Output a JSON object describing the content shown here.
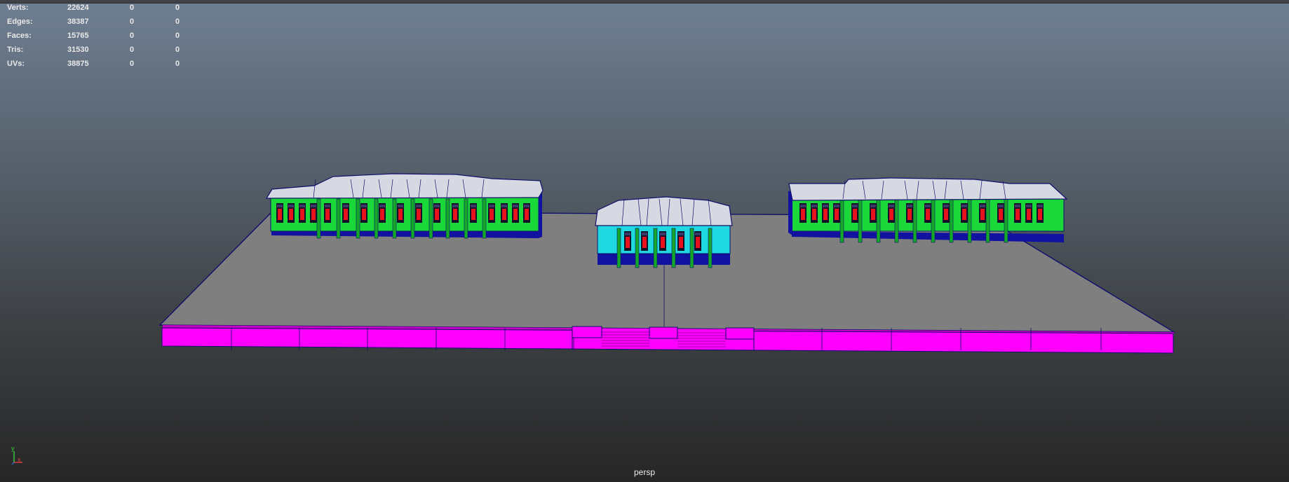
{
  "viewport": {
    "camera_label": "persp",
    "background_top": "#6f7f92",
    "background_bottom": "#262626"
  },
  "hud": {
    "rows": [
      {
        "label": "Verts:",
        "values": [
          "22624",
          "0",
          "0"
        ]
      },
      {
        "label": "Edges:",
        "values": [
          "38387",
          "0",
          "0"
        ]
      },
      {
        "label": "Faces:",
        "values": [
          "15765",
          "0",
          "0"
        ]
      },
      {
        "label": "Tris:",
        "values": [
          "31530",
          "0",
          "0"
        ]
      },
      {
        "label": "UVs:",
        "values": [
          "38875",
          "0",
          "0"
        ]
      }
    ]
  },
  "colors": {
    "platform": "#7f7f7f",
    "wall": "#1bd83a",
    "column": "#14a82a",
    "window_red": "#e8121c",
    "window_frame": "#101028",
    "base": "#1212a0",
    "cyan_wall": "#1fd8e0",
    "roof": "#d6d8e2",
    "magenta": "#ff00ff",
    "wire": "#10106a"
  },
  "axis_gizmo": {
    "x_label": "x",
    "y_label": "y"
  }
}
